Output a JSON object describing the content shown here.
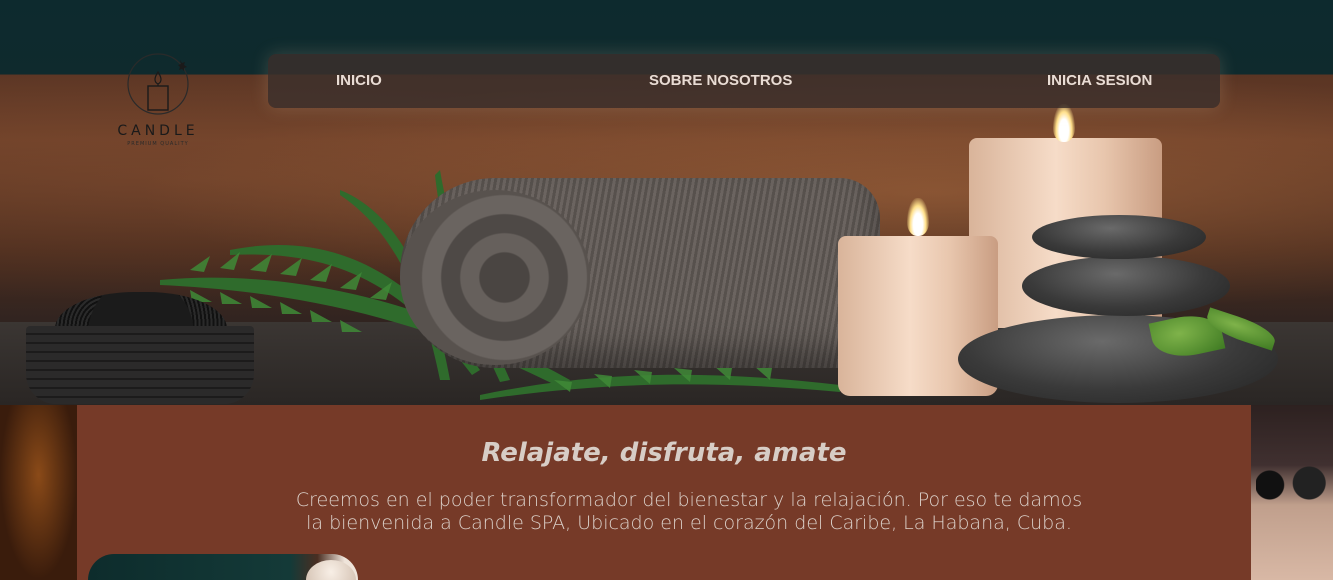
{
  "brand": {
    "name": "CANDLE",
    "tagline_small": "PREMIUM QUALITY"
  },
  "nav": {
    "items": [
      {
        "label": "INICIO"
      },
      {
        "label": "SOBRE NOSOTROS"
      },
      {
        "label": "INICIA SESION"
      }
    ]
  },
  "hero": {
    "image": "spa-towel-candles-stones"
  },
  "content": {
    "tagline": "Relajate, disfruta, amate",
    "intro": "Creemos en el poder transformador del bienestar y la relajación. Por eso te damos la bienvenida a Candle SPA, Ubicado en el corazón del Caribe, La Habana, Cuba."
  },
  "colors": {
    "panel": "#763a28",
    "nav_bg": "#3c302c",
    "text_light": "#dcd1ca"
  }
}
